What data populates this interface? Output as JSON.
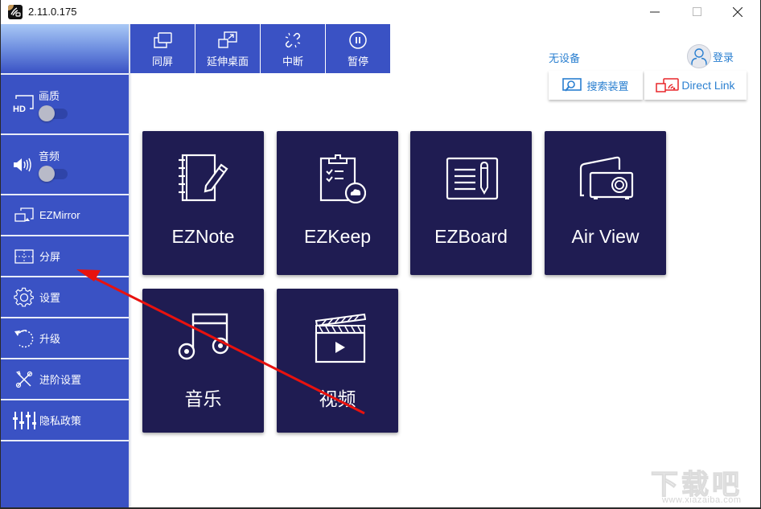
{
  "window": {
    "title": "2.11.0.175",
    "controls": {
      "minimize": "—",
      "maximize": "☐",
      "close": "✕"
    }
  },
  "toolbar": {
    "buttons": [
      {
        "label": "同屏",
        "icon": "mirror-screen-icon"
      },
      {
        "label": "延伸桌面",
        "icon": "extend-desktop-icon"
      },
      {
        "label": "中断",
        "icon": "disconnect-icon"
      },
      {
        "label": "暂停",
        "icon": "pause-icon"
      }
    ]
  },
  "sidebar": {
    "toggles": [
      {
        "label": "画质",
        "icon": "hd-icon",
        "on": false
      },
      {
        "label": "音频",
        "icon": "speaker-icon",
        "on": false
      }
    ],
    "items": [
      {
        "label": "EZMirror",
        "icon": "ezmirror-icon"
      },
      {
        "label": "分屏",
        "icon": "split-screen-icon"
      },
      {
        "label": "设置",
        "icon": "gear-icon"
      },
      {
        "label": "升级",
        "icon": "upgrade-icon"
      },
      {
        "label": "进阶设置",
        "icon": "tools-icon"
      },
      {
        "label": "隐私政策",
        "icon": "sliders-icon"
      }
    ]
  },
  "header": {
    "device_status": "无设备",
    "login_label": "登录",
    "search_button": "搜索装置",
    "direct_link_button": "Direct Link"
  },
  "tiles": [
    {
      "label": "EZNote",
      "icon": "notebook-pencil-icon"
    },
    {
      "label": "EZKeep",
      "icon": "clipboard-cloud-icon"
    },
    {
      "label": "EZBoard",
      "icon": "whiteboard-icon"
    },
    {
      "label": "Air View",
      "icon": "projector-icon"
    },
    {
      "label": "音乐",
      "icon": "music-note-icon"
    },
    {
      "label": "视频",
      "icon": "clapperboard-icon"
    }
  ],
  "colors": {
    "sidebar_bg": "#3a52c4",
    "tile_bg": "#1f1c52",
    "link_blue": "#2a7fd0",
    "direct_link_red": "#e8262a",
    "annotation_red": "#e8120e"
  },
  "watermark": {
    "big": "下载吧",
    "small": "www.xiazaiba.com"
  }
}
